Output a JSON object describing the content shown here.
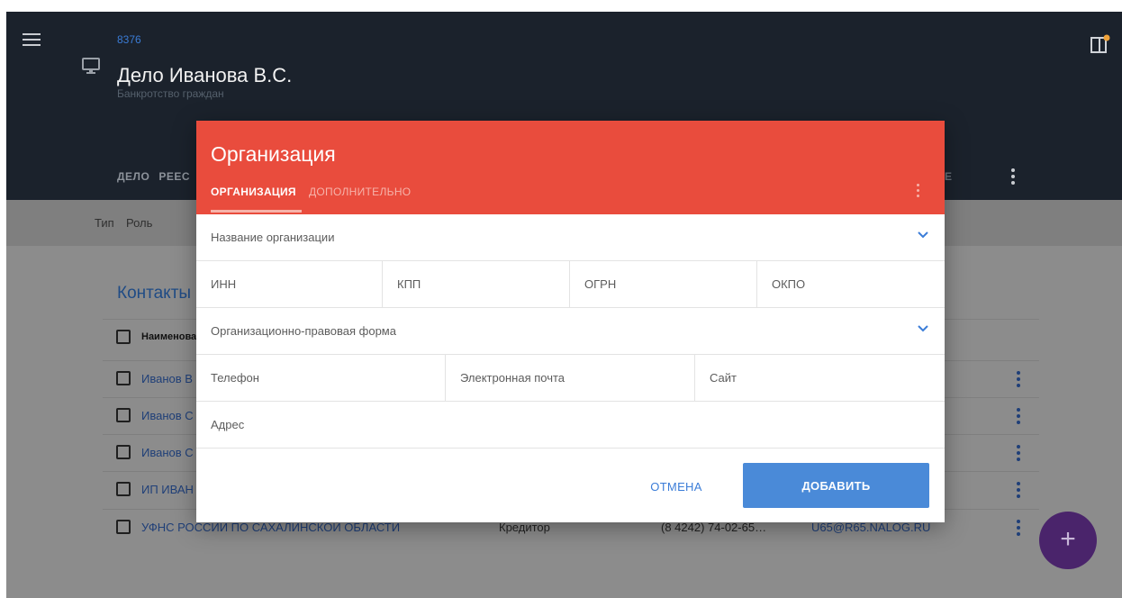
{
  "header": {
    "case_number": "8376",
    "case_title": "Дело Иванова В.С.",
    "case_subtitle": "Банкротство граждан",
    "nav": [
      "ДЕЛО",
      "РЕЕС"
    ],
    "nav_right": "Е"
  },
  "filters": [
    "Тип",
    "Роль"
  ],
  "contacts": {
    "title": "Контакты",
    "header_cell": "Наименова",
    "rows": [
      {
        "name": "Иванов В",
        "role": "",
        "phone": "",
        "email": ""
      },
      {
        "name": "Иванов С",
        "role": "",
        "phone": "",
        "email": ""
      },
      {
        "name": "Иванов С",
        "role": "",
        "phone": "",
        "email": ""
      },
      {
        "name": "ИП ИВАН",
        "role": "",
        "phone": "",
        "email": ""
      },
      {
        "name": "УФНС РОССИИ ПО САХАЛИНСКОЙ ОБЛАСТИ",
        "role": "Кредитор",
        "phone": "(8 4242) 74-02-65…",
        "email": "U65@R65.NALOG.RU"
      }
    ]
  },
  "fab": {
    "label": "+"
  },
  "modal": {
    "title": "Организация",
    "tabs": [
      "ОРГАНИЗАЦИЯ",
      "ДОПОЛНИТЕЛЬНО"
    ],
    "fields": {
      "org_name": "Название организации",
      "inn": "ИНН",
      "kpp": "КПП",
      "ogrn": "ОГРН",
      "okpo": "ОКПО",
      "legal_form": "Организационно-правовая форма",
      "phone": "Телефон",
      "email": "Электронная почта",
      "site": "Сайт",
      "address": "Адрес"
    },
    "cancel_label": "ОТМЕНА",
    "add_label": "ДОБАВИТЬ"
  },
  "colors": {
    "modal_header": "#e94c3d",
    "primary_button": "#4a8ad8",
    "link": "#3b7dd8",
    "topbar": "#1b222c",
    "fab": "#4a246b"
  },
  "icons": {
    "menu": "hamburger-menu-icon",
    "case": "monitor-icon",
    "top_right": "panel-notification-icon",
    "chevron": "chevron-down-icon",
    "more": "kebab-menu-icon"
  }
}
